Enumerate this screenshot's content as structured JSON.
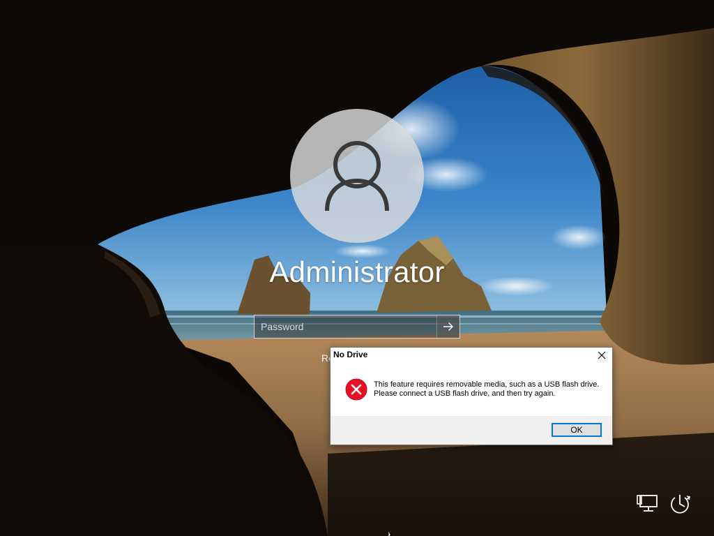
{
  "login": {
    "username": "Administrator",
    "password_placeholder": "Password",
    "password_value": "",
    "reset_link_fragment": "Re"
  },
  "dialog": {
    "title": "No Drive",
    "message_line1": "This feature requires removable media, such as a USB flash drive.",
    "message_line2": "Please connect a USB flash drive, and then try again.",
    "ok_label": "OK",
    "icon": "error-icon"
  },
  "system_tray": {
    "icons": [
      "network-icon",
      "power-icon"
    ]
  },
  "colors": {
    "dialog_accent": "#0078d7",
    "error_red": "#e81123",
    "dialog_footer": "#f0f0f0"
  }
}
